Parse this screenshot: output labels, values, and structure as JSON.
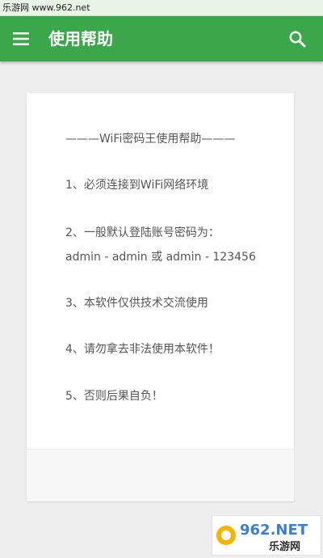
{
  "watermark": {
    "site": "乐游网 www.962.net"
  },
  "app_bar": {
    "title": "使用帮助",
    "menu_icon": "hamburger-menu-icon",
    "search_icon": "search-icon",
    "color": "#3aa84a"
  },
  "help": {
    "title": "———WiFi密码王使用帮助———",
    "items": [
      "1、必须连接到WiFi网络环境",
      "2、一般默认登陆账号密码为：",
      "admin - admin 或 admin - 123456",
      "3、本软件仅供技术交流使用",
      "4、请勿拿去非法使用本软件！",
      "5、否则后果自负！"
    ]
  },
  "logo": {
    "text_top": "962.NET",
    "text_bottom": "乐游网"
  }
}
